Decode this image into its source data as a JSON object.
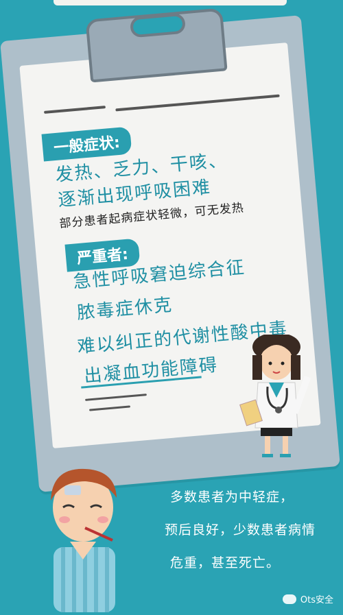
{
  "general": {
    "tag": "一般症状:",
    "lines": [
      "发热、乏力、干咳、",
      "逐渐出现呼吸困难"
    ],
    "note": "部分患者起病症状轻微，可无发热"
  },
  "severe": {
    "tag": "严重者:",
    "lines": [
      "急性呼吸窘迫综合征",
      "脓毒症休克",
      "难以纠正的代谢性酸中毒",
      "出凝血功能障碍"
    ]
  },
  "footer": {
    "lines": [
      "多数患者为中轻症，",
      "预后良好，少数患者病情",
      "危重，甚至死亡。"
    ]
  },
  "watermark": {
    "text": "Ots安全"
  },
  "icons": {
    "clipboard": "clipboard-icon",
    "doctor": "doctor-illustration",
    "patient": "patient-illustration",
    "watermark": "wechat-icon"
  },
  "colors": {
    "background": "#2aa3b4",
    "accent": "#2a9fb0",
    "paper": "#f4f4f2"
  }
}
